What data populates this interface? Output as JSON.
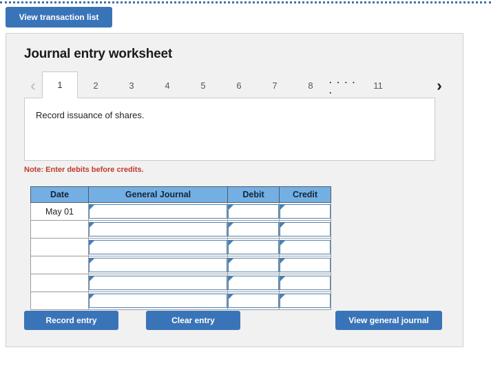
{
  "top": {
    "view_transaction_list_label": "View transaction list"
  },
  "panel": {
    "title": "Journal entry worksheet",
    "pager": {
      "prev_icon": "chevron-left-icon",
      "next_icon": "chevron-right-icon",
      "prev_glyph": "‹",
      "next_glyph": "›",
      "tabs": [
        {
          "label": "1",
          "active": true
        },
        {
          "label": "2",
          "active": false
        },
        {
          "label": "3",
          "active": false
        },
        {
          "label": "4",
          "active": false
        },
        {
          "label": "5",
          "active": false
        },
        {
          "label": "6",
          "active": false
        },
        {
          "label": "7",
          "active": false
        },
        {
          "label": "8",
          "active": false
        },
        {
          "label": ". . . . .",
          "active": false,
          "ellipsis": true
        },
        {
          "label": "11",
          "active": false
        }
      ]
    },
    "instruction": "Record issuance of shares.",
    "note": "Note: Enter debits before credits.",
    "table": {
      "headers": [
        "Date",
        "General Journal",
        "Debit",
        "Credit"
      ],
      "rows": [
        {
          "date": "May 01",
          "journal": "",
          "debit": "",
          "credit": ""
        },
        {
          "date": "",
          "journal": "",
          "debit": "",
          "credit": ""
        },
        {
          "date": "",
          "journal": "",
          "debit": "",
          "credit": ""
        },
        {
          "date": "",
          "journal": "",
          "debit": "",
          "credit": ""
        },
        {
          "date": "",
          "journal": "",
          "debit": "",
          "credit": ""
        },
        {
          "date": "",
          "journal": "",
          "debit": "",
          "credit": ""
        }
      ]
    },
    "actions": {
      "record_entry_label": "Record entry",
      "clear_entry_label": "Clear entry",
      "view_general_journal_label": "View general journal"
    }
  },
  "colors": {
    "button_blue": "#3a74b8",
    "table_header_blue": "#74afe3",
    "cell_border_blue": "#4a80b5",
    "note_red": "#c0392b",
    "panel_bg": "#f1f1f1",
    "panel_border": "#cfcfcf",
    "top_rule": "#3f6fa8"
  }
}
